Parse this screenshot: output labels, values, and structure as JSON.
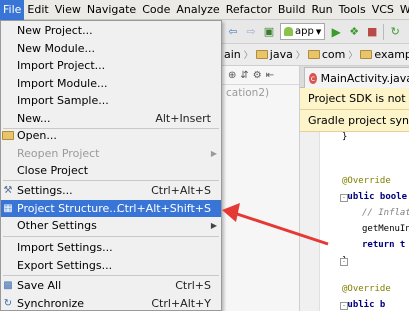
{
  "menubar": {
    "items": [
      {
        "label": "File",
        "active": true
      },
      {
        "label": "Edit"
      },
      {
        "label": "View"
      },
      {
        "label": "Navigate"
      },
      {
        "label": "Code"
      },
      {
        "label": "Analyze"
      },
      {
        "label": "Refactor"
      },
      {
        "label": "Build"
      },
      {
        "label": "Run"
      },
      {
        "label": "Tools"
      },
      {
        "label": "VCS"
      },
      {
        "label": "W"
      }
    ]
  },
  "toolbar": {
    "run_config": "app"
  },
  "breadcrumb": {
    "items": [
      "ain",
      "java",
      "com",
      "example"
    ]
  },
  "project_panel": {
    "hint_text": "cation2)"
  },
  "editor": {
    "tab_label": "MainActivity.java",
    "notice_sdk": "Project SDK is not de",
    "notice_gradle": "Gradle project sync f",
    "code": {
      "line1": "}",
      "line2": "@Override",
      "line3": "public boole",
      "line4": "// Inflate",
      "line5": "getMenuInf",
      "line6": "return t",
      "line7": "}",
      "line8": "@Override",
      "line9": "public b"
    }
  },
  "file_menu": {
    "new_project": "New Project...",
    "new_module": "New Module...",
    "import_project": "Import Project...",
    "import_module": "Import Module...",
    "import_sample": "Import Sample...",
    "new": "New...",
    "new_shortcut": "Alt+Insert",
    "open": "Open...",
    "reopen_project": "Reopen Project",
    "close_project": "Close Project",
    "settings": "Settings...",
    "settings_shortcut": "Ctrl+Alt+S",
    "project_structure": "Project Structure...",
    "project_structure_shortcut": "Ctrl+Alt+Shift+S",
    "other_settings": "Other Settings",
    "import_settings": "Import Settings...",
    "export_settings": "Export Settings...",
    "save_all": "Save All",
    "save_all_shortcut": "Ctrl+S",
    "synchronize": "Synchronize",
    "synchronize_shortcut": "Ctrl+Alt+Y"
  },
  "colors": {
    "selection": "#3875d7",
    "arrow": "#e53935",
    "notice_bg": "#fdf4c9"
  }
}
